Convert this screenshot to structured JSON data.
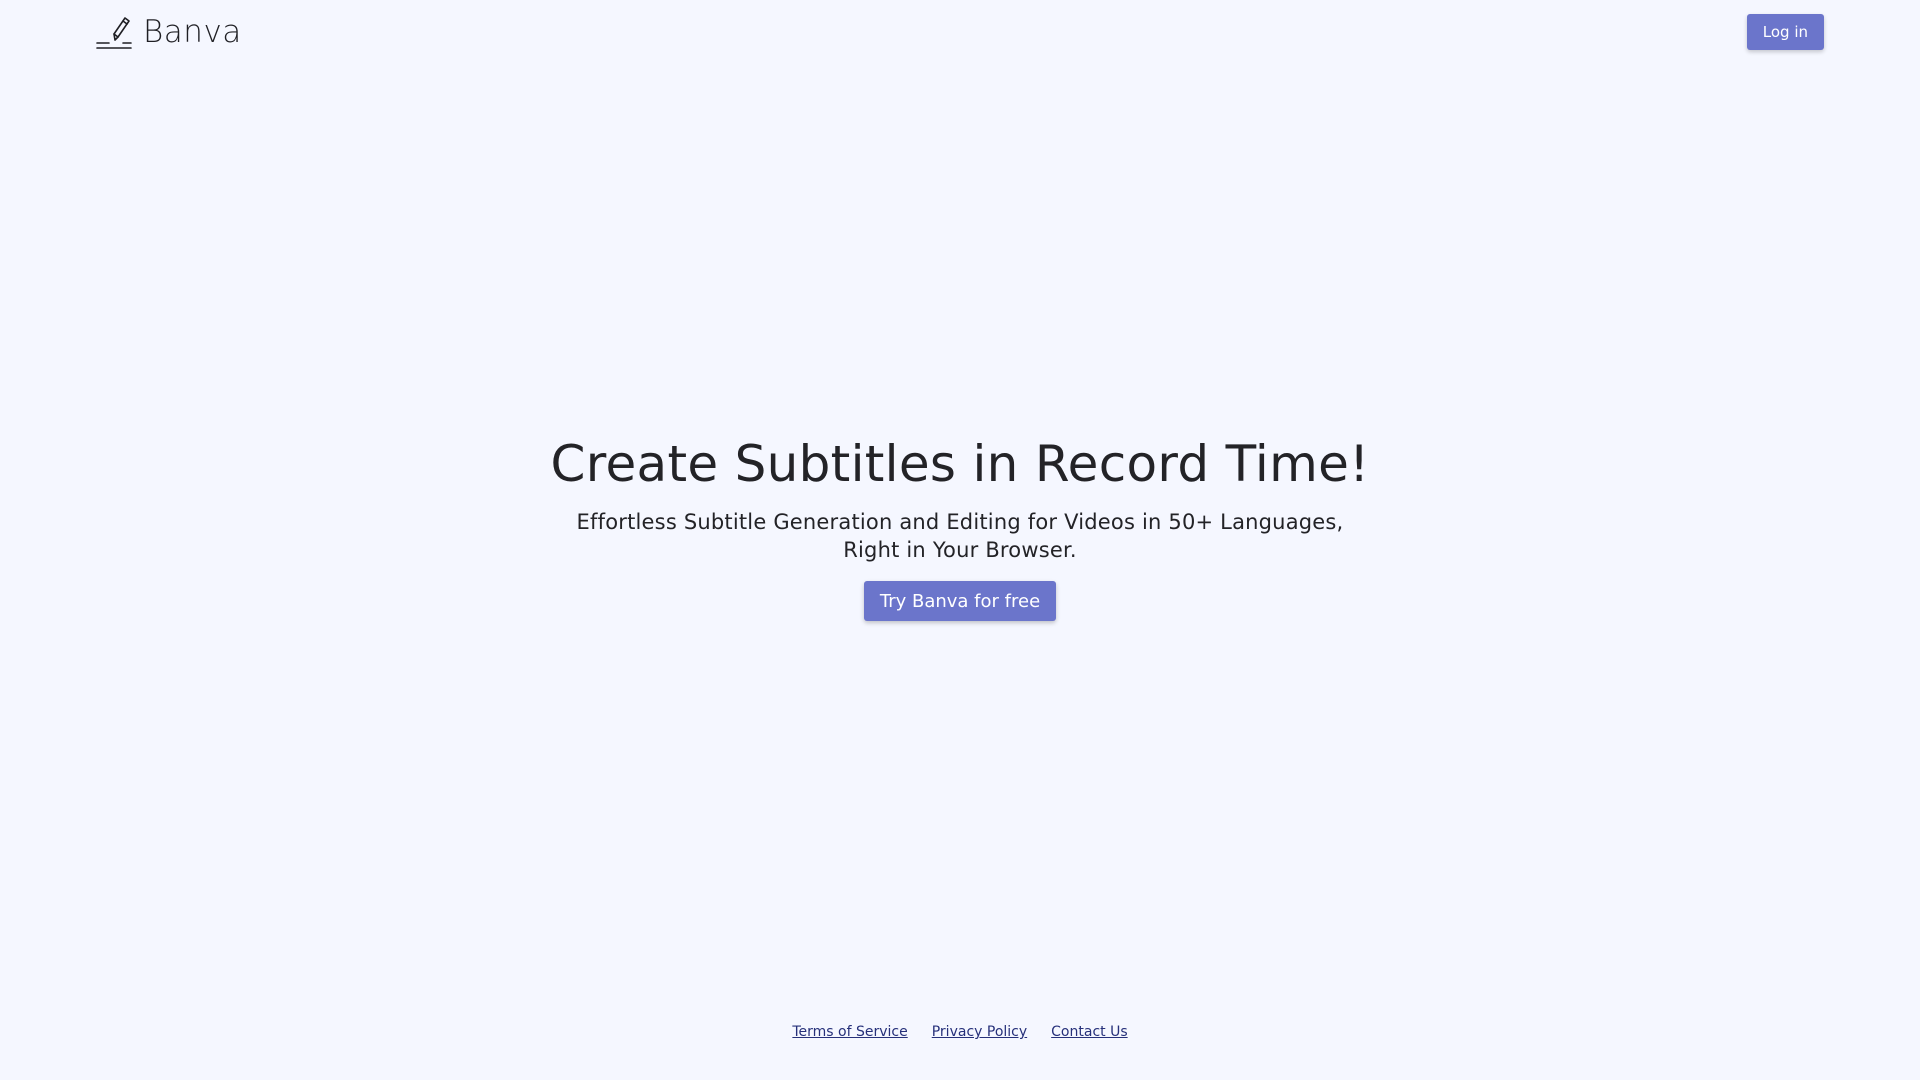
{
  "header": {
    "brand_name": "Banva",
    "brand_icon": "pen-signature-icon",
    "login_label": "Log in"
  },
  "hero": {
    "title": "Create Subtitles in Record Time!",
    "subtitle": "Effortless Subtitle Generation and Editing for Videos in 50+ Languages, Right in Your Browser.",
    "cta_label": "Try Banva for free"
  },
  "footer": {
    "links": [
      {
        "label": "Terms of Service"
      },
      {
        "label": "Privacy Policy"
      },
      {
        "label": "Contact Us"
      }
    ]
  },
  "colors": {
    "background": "#f5f7ff",
    "accent": "#6b75cb",
    "footer_link": "#26307a",
    "text": "#232327"
  }
}
